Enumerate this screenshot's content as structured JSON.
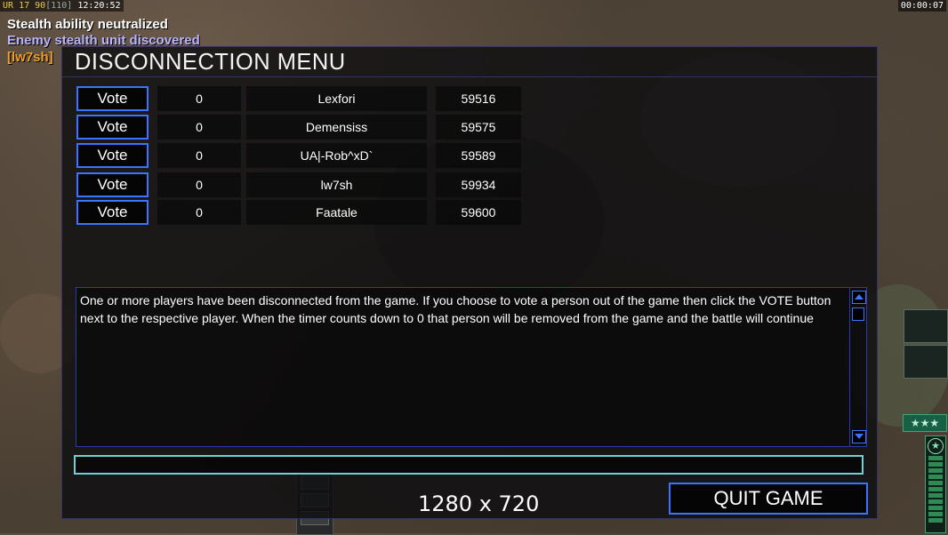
{
  "hud": {
    "stats_prefix": "UR",
    "stats_a": "17",
    "stats_b": "90",
    "stats_c": "[110]",
    "clock": "12:20:52",
    "timer": "00:00:07"
  },
  "messages": [
    "Stealth ability neutralized",
    "Enemy stealth unit discovered",
    "[lw7sh]"
  ],
  "dialog": {
    "title": "DISCONNECTION MENU",
    "vote_label": "Vote",
    "players": [
      {
        "votes": "0",
        "name": "Lexfori",
        "value": "59516"
      },
      {
        "votes": "0",
        "name": "Demensiss",
        "value": "59575"
      },
      {
        "votes": "0",
        "name": "UA|-Rob^xD`",
        "value": "59589"
      },
      {
        "votes": "0",
        "name": "lw7sh",
        "value": "59934"
      },
      {
        "votes": "0",
        "name": "Faatale",
        "value": "59600"
      }
    ],
    "info_text": "One or more players have been disconnected from the game. If you choose to vote a person out of the game then click the VOTE button next to the respective player. When the timer counts down to 0 that person will be removed from the game and the battle will continue",
    "chat_value": "",
    "resolution": "1280 x 720",
    "quit_label": "QUIT GAME"
  },
  "side": {
    "stars": "★★★",
    "rank_icon": "★"
  },
  "colors": {
    "accent_blue": "#3b74ff",
    "input_cyan": "#6fd0d8",
    "msg_purple": "#b7b3ff",
    "msg_orange": "#f0a020"
  }
}
